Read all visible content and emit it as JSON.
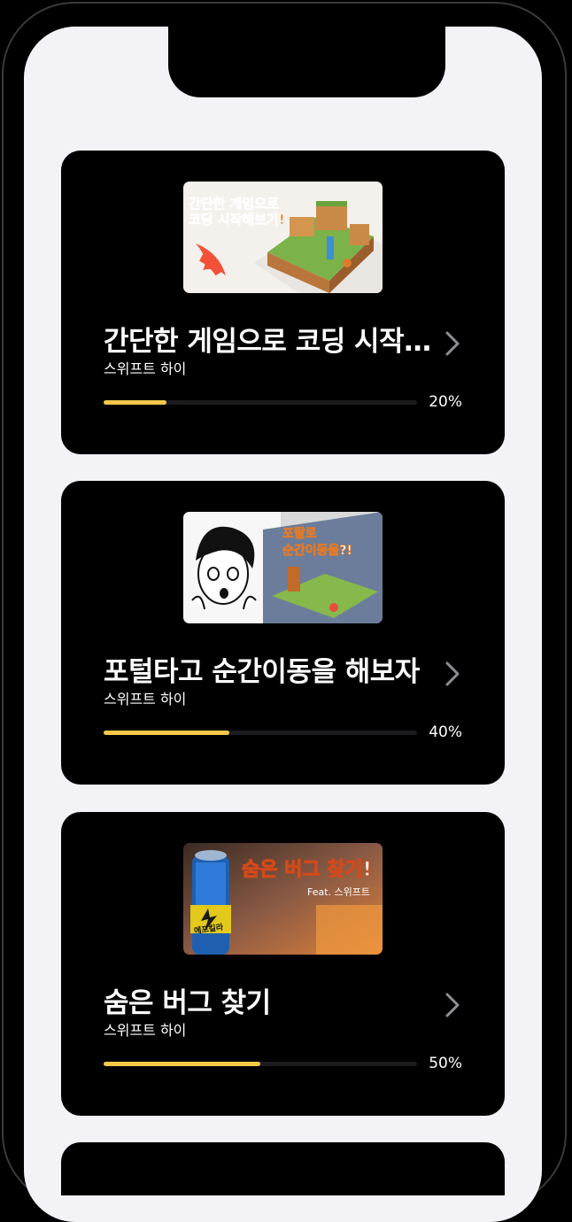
{
  "colors": {
    "screen_bg": "#f2f2f7",
    "card_bg": "#000000",
    "progress_fill": "#f5c84a",
    "progress_track": "#1c1c1e"
  },
  "courses": [
    {
      "title": "간단한 게임으로 코딩 시작해보기",
      "author": "스위프트 하이",
      "progress_label": "20%",
      "progress": 0.2,
      "thumbnail": {
        "line1": "간단한 게임으로",
        "line2": "코딩 시작해보기!"
      }
    },
    {
      "title": "포털타고 순간이동을 해보자",
      "author": "스위프트 하이",
      "progress_label": "40%",
      "progress": 0.4,
      "thumbnail": {
        "line1": "포탈로",
        "line2": "순간이동을?!"
      }
    },
    {
      "title": "숨은 버그 찾기",
      "author": "스위프트 하이",
      "progress_label": "50%",
      "progress": 0.5,
      "thumbnail": {
        "line1": "숨은 버그 찾기!",
        "line2": "Feat. 스위프트",
        "can_label": "에프킬라"
      }
    }
  ]
}
